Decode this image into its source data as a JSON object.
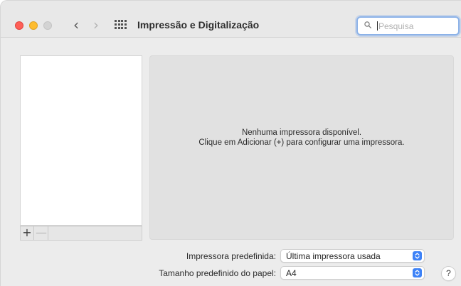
{
  "window": {
    "title": "Impressão e Digitalização"
  },
  "toolbar": {
    "back_glyph": "‹",
    "forward_glyph": "›",
    "search_placeholder": "Pesquisa",
    "search_value": ""
  },
  "printer_list": {
    "add_label": "+",
    "remove_label": "—"
  },
  "detail": {
    "empty_line1": "Nenhuma impressora disponível.",
    "empty_line2": "Clique em Adicionar (+) para configurar uma impressora."
  },
  "settings": {
    "default_printer_label": "Impressora predefinida:",
    "default_printer_value": "Última impressora usada",
    "paper_size_label": "Tamanho predefinido do papel:",
    "paper_size_value": "A4"
  },
  "help_label": "?",
  "colors": {
    "close": "#fe5f57",
    "minimize": "#febc2e",
    "zoom_inactive": "#d3d3d3",
    "accent": "#3d82f7",
    "search_focus": "#8cb2e8"
  }
}
